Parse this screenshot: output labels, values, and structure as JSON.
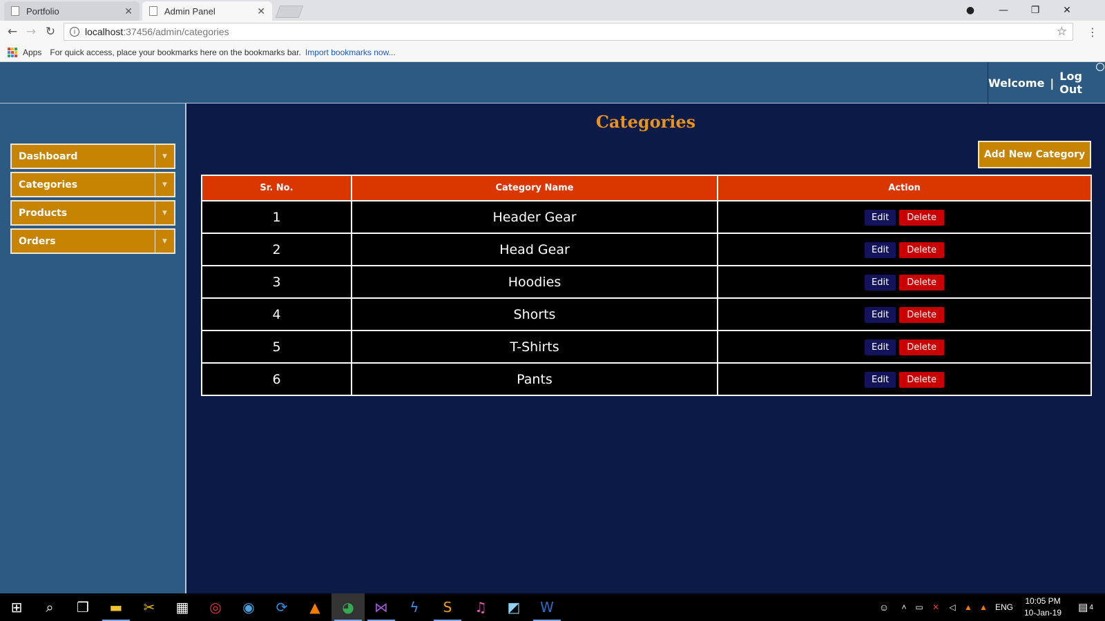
{
  "browser": {
    "tabs": [
      {
        "label": "Portfolio",
        "active": false
      },
      {
        "label": "Admin Panel",
        "active": true
      }
    ],
    "url": {
      "host": "localhost",
      "path": ":37456/admin/categories"
    },
    "bookmarks": {
      "apps_label": "Apps",
      "hint": "For quick access, place your bookmarks here on the bookmarks bar.",
      "import_link": "Import bookmarks now..."
    }
  },
  "header": {
    "welcome": "Welcome",
    "separator": "|",
    "logout": "Log Out"
  },
  "sidebar": {
    "items": [
      {
        "label": "Dashboard"
      },
      {
        "label": "Categories"
      },
      {
        "label": "Products"
      },
      {
        "label": "Orders"
      }
    ]
  },
  "main": {
    "title": "Categories",
    "add_button": "Add New Category",
    "table": {
      "headers": [
        "Sr. No.",
        "Category Name",
        "Action"
      ],
      "rows": [
        {
          "sr": "1",
          "name": "Header Gear"
        },
        {
          "sr": "2",
          "name": "Head Gear"
        },
        {
          "sr": "3",
          "name": "Hoodies"
        },
        {
          "sr": "4",
          "name": "Shorts"
        },
        {
          "sr": "5",
          "name": "T-Shirts"
        },
        {
          "sr": "6",
          "name": "Pants"
        }
      ],
      "edit_label": "Edit",
      "delete_label": "Delete"
    }
  },
  "taskbar": {
    "language": "ENG",
    "time": "10:05 PM",
    "date": "10-Jan-19",
    "notifications": "4"
  },
  "colors": {
    "page_bg": "#0b1a46",
    "header_bg": "#2c5a82",
    "sidebar_item": "#c68402",
    "title": "#e69120",
    "table_header": "#d93600",
    "edit_button": "#13135c",
    "delete_button": "#c90000"
  }
}
